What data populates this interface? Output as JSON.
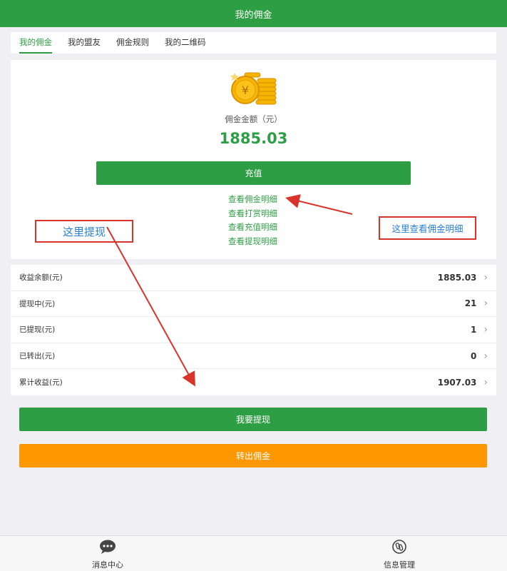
{
  "header": {
    "title": "我的佣金"
  },
  "tabs": [
    {
      "label": "我的佣金"
    },
    {
      "label": "我的盟友"
    },
    {
      "label": "佣金规则"
    },
    {
      "label": "我的二维码"
    }
  ],
  "summary": {
    "amount_label": "佣金金额（元）",
    "amount_value": "1885.03",
    "recharge_label": "充值"
  },
  "links": [
    {
      "label": "查看佣金明细"
    },
    {
      "label": "查看打赏明细"
    },
    {
      "label": "查看充值明细"
    },
    {
      "label": "查看提现明细"
    }
  ],
  "stats": [
    {
      "label": "收益余额(元)",
      "value": "1885.03"
    },
    {
      "label": "提现中(元)",
      "value": "21"
    },
    {
      "label": "已提现(元)",
      "value": "1"
    },
    {
      "label": "已转出(元)",
      "value": "0"
    },
    {
      "label": "累计收益(元)",
      "value": "1907.03"
    }
  ],
  "actions": {
    "withdraw_label": "我要提现",
    "transfer_label": "转出佣金"
  },
  "bottom_nav": [
    {
      "label": "消息中心",
      "icon": "chat-icon"
    },
    {
      "label": "信息管理",
      "icon": "link-icon"
    }
  ],
  "annotations": {
    "withdraw_here": "这里提现",
    "view_details_here": "这里查看佣金明细"
  },
  "colors": {
    "primary_green": "#2e9e44",
    "orange": "#ff9800",
    "annotation_red": "#d9342b",
    "annotation_blue": "#2a7fd4"
  }
}
